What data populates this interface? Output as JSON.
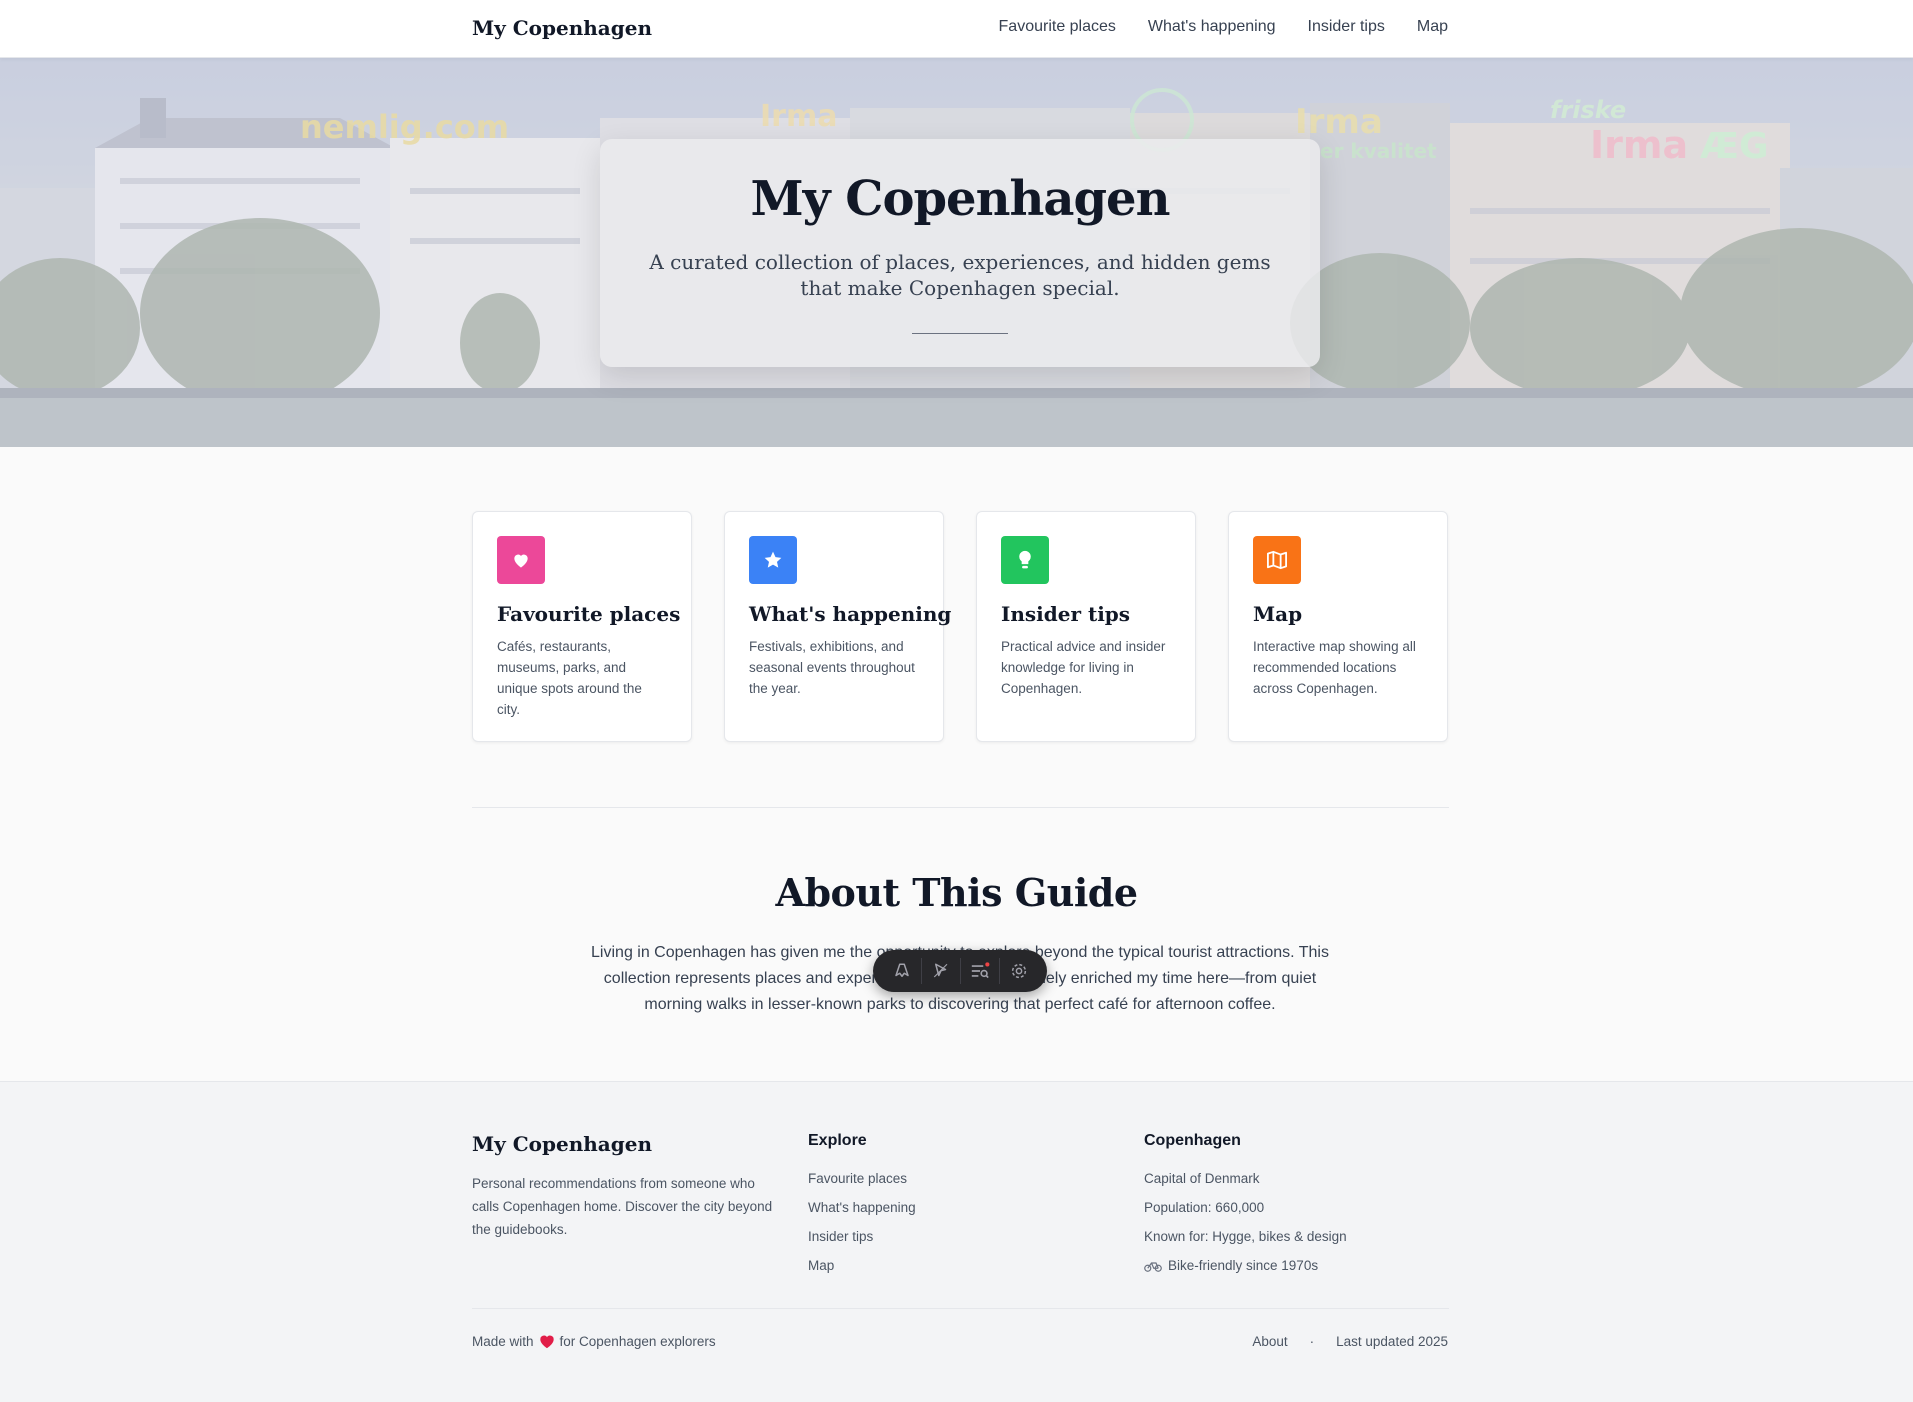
{
  "nav": {
    "brand": "My Copenhagen",
    "links": [
      "Favourite places",
      "What's happening",
      "Insider tips",
      "Map"
    ]
  },
  "hero": {
    "signs": [
      "nemlig.com",
      "Irma",
      "Irma",
      "er kvalitet",
      "friske",
      "Irma",
      "ÆG"
    ],
    "title": "My Copenhagen",
    "subtitle": "A curated collection of places, experiences, and hidden gems that make Copenhagen special."
  },
  "cards": [
    {
      "title": "Favourite places",
      "desc": "Cafés, restaurants, museums, parks, and unique spots around the city.",
      "icon": "heart-icon",
      "color": "#ec4899"
    },
    {
      "title": "What's happening",
      "desc": "Festivals, exhibitions, and seasonal events throughout the year.",
      "icon": "star-icon",
      "color": "#3b82f6"
    },
    {
      "title": "Insider tips",
      "desc": "Practical advice and insider knowledge for living in Copenhagen.",
      "icon": "lightbulb-icon",
      "color": "#22c55e"
    },
    {
      "title": "Map",
      "desc": "Interactive map showing all recommended locations across Copenhagen.",
      "icon": "map-icon",
      "color": "#f97316"
    }
  ],
  "about": {
    "title": "About This Guide",
    "text": "Living in Copenhagen has given me the opportunity to explore beyond the typical tourist attractions. This collection represents places and experiences that have genuinely enriched my time here—from quiet morning walks in lesser-known parks to discovering that perfect café for afternoon coffee."
  },
  "toolbar": {
    "icons": [
      "astro-logo-icon",
      "inspect-cursor-icon",
      "audit-list-icon",
      "settings-gear-icon"
    ]
  },
  "footer": {
    "brand": "My Copenhagen",
    "description": "Personal recommendations from someone who calls Copenhagen home. Discover the city beyond the guidebooks.",
    "explore": {
      "heading": "Explore",
      "links": [
        "Favourite places",
        "What's happening",
        "Insider tips",
        "Map"
      ]
    },
    "city": {
      "heading": "Copenhagen",
      "facts": [
        "Capital of Denmark",
        "Population: 660,000",
        "Known for: Hygge, bikes & design",
        "Bike-friendly since 1970s"
      ]
    },
    "made_with_prefix": "Made with",
    "made_with_suffix": "for Copenhagen explorers",
    "about_link": "About",
    "separator": "·",
    "last_updated": "Last updated 2025"
  }
}
